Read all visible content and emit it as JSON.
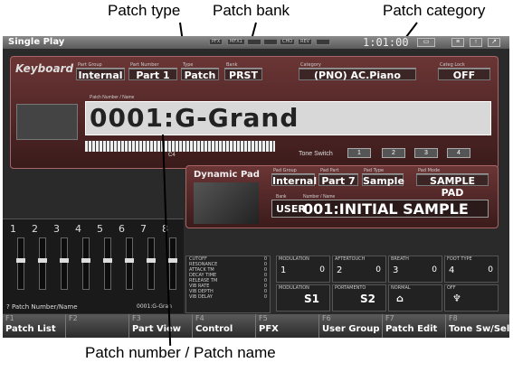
{
  "callouts": {
    "patch_type": "Patch type",
    "patch_bank": "Patch bank",
    "patch_category": "Patch category",
    "patch_number_name": "Patch number / Patch name"
  },
  "titlebar": {
    "title": "Single Play",
    "indicators": [
      "PFX",
      "MFX1",
      "",
      "",
      "CHO",
      "REV",
      ""
    ],
    "clock": "1:01:00"
  },
  "keyboard": {
    "label": "Keyboard",
    "part_group_cap": "Part Group",
    "part_group": "Internal",
    "part_number_cap": "Part Number",
    "part_number": "Part 1",
    "type_cap": "Type",
    "type": "Patch",
    "bank_cap": "Bank",
    "bank": "PRST",
    "category_cap": "Category",
    "category": "(PNO) AC.Piano",
    "categ_lock_cap": "Categ Lock",
    "categ_lock": "OFF",
    "name_cap": "Patch Number / Name",
    "patch_name": "0001:G-Grand",
    "key_mark": "C4",
    "tone_switch_label": "Tone Switch",
    "tone_buttons": [
      "1",
      "2",
      "3",
      "4"
    ]
  },
  "dynamic_pad": {
    "label": "Dynamic Pad",
    "pad_group_cap": "Pad Group",
    "pad_group": "Internal",
    "pad_part_cap": "Pad Part",
    "pad_part": "Part 7",
    "pad_type_cap": "Pad Type",
    "pad_type": "Sample",
    "pad_mode_cap": "Pad Mode",
    "pad_mode": "SAMPLE PAD",
    "bank_cap": "Bank",
    "bank": "USER",
    "name_cap": "Number / Name",
    "name": "001:INITIAL SAMPLE"
  },
  "mixer": {
    "channels": [
      "1",
      "2",
      "3",
      "4",
      "5",
      "6",
      "7",
      "8"
    ],
    "footer_label": "Patch Number/Name",
    "footer_value": "0001:G-Gran"
  },
  "params": [
    {
      "label": "CUTOFF",
      "value": "0"
    },
    {
      "label": "RESONANCE",
      "value": "0"
    },
    {
      "label": "ATTACK TM",
      "value": "0"
    },
    {
      "label": "DECAY TIME",
      "value": "0"
    },
    {
      "label": "RELEASE TM",
      "value": "0"
    },
    {
      "label": "VIB RATE",
      "value": "0"
    },
    {
      "label": "VIB DEPTH",
      "value": "0"
    },
    {
      "label": "VIB DELAY",
      "value": "0"
    }
  ],
  "controllers": {
    "modulation": {
      "cap": "MODULATION",
      "num": "1",
      "value": "0"
    },
    "aftertouch": {
      "cap": "AFTERTOUCH",
      "num": "2",
      "value": "0"
    },
    "breath": {
      "cap": "BREATH",
      "num": "3",
      "value": "0"
    },
    "foot_type": {
      "cap": "FOOT TYPE",
      "num": "4",
      "value": "0"
    },
    "mod2": {
      "cap": "MODULATION",
      "big": "S1"
    },
    "portamento": {
      "cap": "PORTAMENTO",
      "big": "S2"
    },
    "normal": {
      "cap": "NORMAL"
    },
    "off": {
      "cap": "OFF"
    }
  },
  "fkeys": [
    {
      "f": "F1",
      "label": "Patch List"
    },
    {
      "f": "F2",
      "label": ""
    },
    {
      "f": "F3",
      "label": "Part View"
    },
    {
      "f": "F4",
      "label": "Control"
    },
    {
      "f": "F5",
      "label": "PFX"
    },
    {
      "f": "F6",
      "label": "User Group"
    },
    {
      "f": "F7",
      "label": "Patch Edit"
    },
    {
      "f": "F8",
      "label": "Tone Sw/Sel"
    }
  ]
}
